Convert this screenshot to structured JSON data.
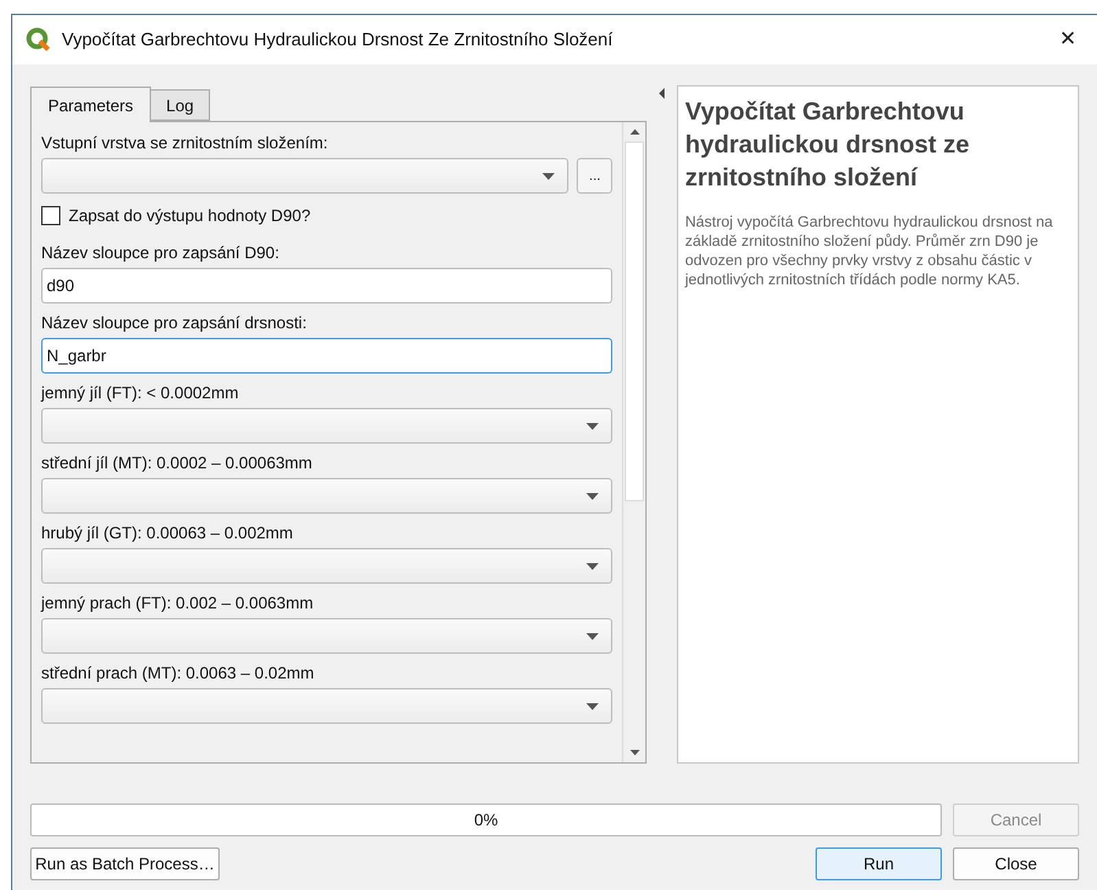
{
  "window": {
    "title": "Vypočítat Garbrechtovu Hydraulickou Drsnost Ze Zrnitostního Složení",
    "close": "✕"
  },
  "tabs": [
    {
      "label": "Parameters",
      "selected": true
    },
    {
      "label": "Log",
      "selected": false
    }
  ],
  "parameters": [
    {
      "kind": "layer",
      "label": "Vstupní vrstva se zrnitostním složením:",
      "browse": "..."
    },
    {
      "kind": "checkbox",
      "label": "Zapsat do výstupu hodnoty D90?",
      "checked": false
    },
    {
      "kind": "text",
      "label": "Název sloupce pro zapsání D90:",
      "value": "d90",
      "focused": false
    },
    {
      "kind": "text",
      "label": "Název sloupce pro zapsání drsnosti:",
      "value": "N_garbr",
      "focused": true
    },
    {
      "kind": "combo",
      "label": "jemný jíl (FT): < 0.0002mm"
    },
    {
      "kind": "combo",
      "label": "střední jíl (MT): 0.0002 – 0.00063mm"
    },
    {
      "kind": "combo",
      "label": "hrubý jíl (GT): 0.00063 – 0.002mm"
    },
    {
      "kind": "combo",
      "label": "jemný prach (FT): 0.002 – 0.0063mm"
    },
    {
      "kind": "combo",
      "label": "střední prach (MT): 0.0063 – 0.02mm"
    }
  ],
  "help": {
    "title": "Vypočítat Garbrechtovu hydraulickou drsnost ze zrnitostního složení",
    "text": "Nástroj vypočítá Garbrechtovu hydraulickou drsnost na základě zrnitostního složení půdy. Průměr zrn D90 je odvozen pro všechny prvky vrstvy z obsahu částic v jednotlivých zrnitostních třídách podle normy KA5."
  },
  "progress": {
    "level": 0,
    "reading": "0%"
  },
  "buttons": [
    {
      "label": "Cancel",
      "disabled": true
    },
    {
      "label": "Run as Batch Process…",
      "disabled": false
    },
    {
      "label": "Run",
      "disabled": false,
      "default": true
    },
    {
      "label": "Close",
      "disabled": false
    }
  ]
}
